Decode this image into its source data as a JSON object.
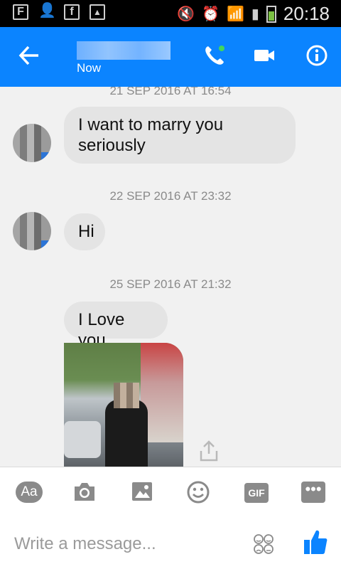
{
  "status_bar": {
    "time": "20:18"
  },
  "header": {
    "contact_name": "",
    "subtitle": "Now"
  },
  "messages": [
    {
      "timestamp": "21 SEP 2016 AT 16:54",
      "text": "I want to marry you seriously"
    },
    {
      "timestamp": "22 SEP 2016 AT 23:32",
      "text": "Hi"
    },
    {
      "timestamp": "25 SEP 2016 AT 21:32",
      "text": "I Love you"
    }
  ],
  "toolbar": {
    "text_button": "Aa",
    "gif_button": "GIF",
    "more_button": "•••"
  },
  "composer": {
    "placeholder": "Write a message..."
  },
  "icons": [
    "back-arrow-icon",
    "phone-icon",
    "video-camera-icon",
    "info-icon",
    "camera-icon",
    "image-icon",
    "smiley-icon",
    "share-icon",
    "emoji-icon",
    "thumbs-up-icon"
  ],
  "colors": {
    "brand": "#0b84ff",
    "bubble": "#e4e4e4",
    "timestamp": "#8a8a8a"
  }
}
